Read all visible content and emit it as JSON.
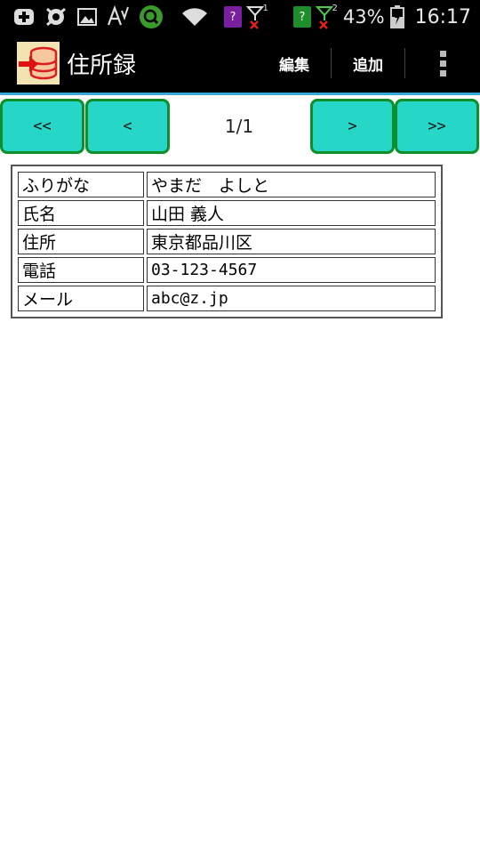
{
  "status_bar": {
    "sim1_label": "?",
    "sim2_label": "?",
    "signal1_sub": "1",
    "signal2_sub": "2",
    "battery_percent": "43%",
    "time": "16:17",
    "icons": [
      "plus-box-icon",
      "avast-icon",
      "gallery-icon",
      "font-size-icon",
      "search-circle-icon",
      "wifi-icon",
      "sim-card-icon",
      "signal-icon",
      "battery-charging-icon"
    ],
    "colors": {
      "sim1": "#7a1fa0",
      "sim2": "#1e8e2a",
      "signal_error": "#e02020",
      "search_circle": "#3a9a2a"
    }
  },
  "action_bar": {
    "title": "住所録",
    "edit_label": "編集",
    "add_label": "追加",
    "accent_line": "#36a9d8"
  },
  "pager": {
    "first_label": "<<",
    "prev_label": "<",
    "page_indicator": "1/1",
    "next_label": ">",
    "last_label": ">>",
    "button_color": "#26d6c6",
    "button_border": "#0f8f2a"
  },
  "record": {
    "rows": [
      {
        "label": "ふりがな",
        "value": "やまだ　よしと"
      },
      {
        "label": "氏名",
        "value": "山田 義人"
      },
      {
        "label": "住所",
        "value": "東京都品川区"
      },
      {
        "label": "電話",
        "value": "03-123-4567"
      },
      {
        "label": "メール",
        "value": "abc@z.jp"
      }
    ]
  }
}
